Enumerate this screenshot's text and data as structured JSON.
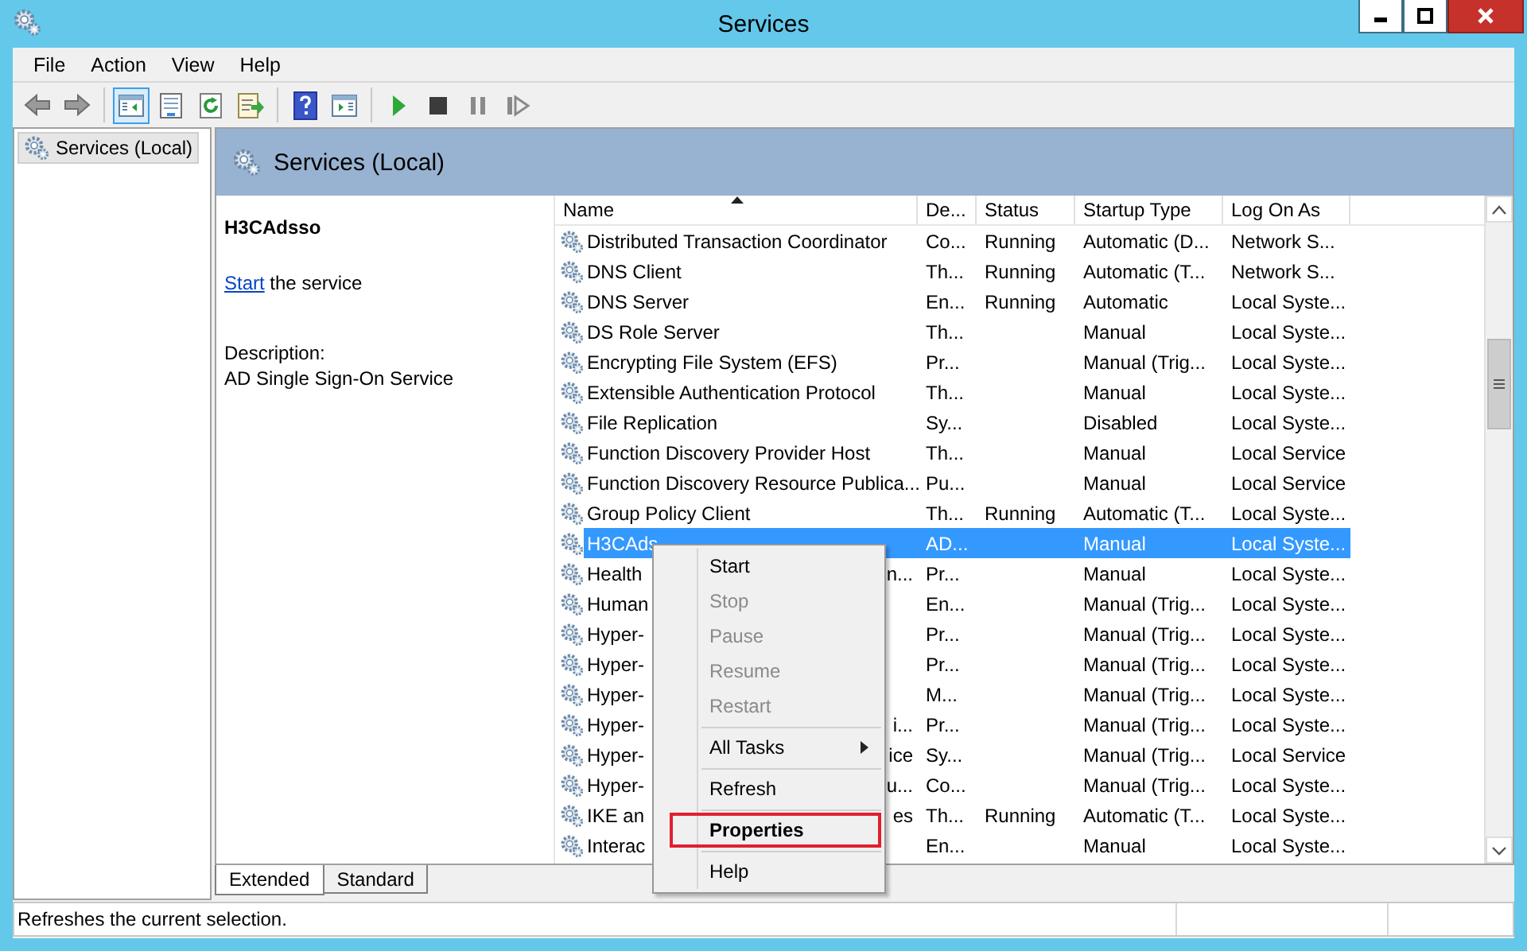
{
  "window": {
    "title": "Services"
  },
  "menu_bar": [
    "File",
    "Action",
    "View",
    "Help"
  ],
  "toolbar": [
    {
      "selected": false
    },
    {
      "selected": false
    },
    {
      "selected": true
    },
    {
      "selected": false
    },
    {
      "selected": false
    },
    {
      "selected": false
    },
    {
      "selected": false
    },
    {
      "selected": false
    },
    {
      "selected": false
    },
    {
      "selected": false
    },
    {
      "selected": false
    },
    {
      "selected": false
    }
  ],
  "tree": {
    "items": [
      {
        "label": "Services (Local)",
        "selected": true
      }
    ]
  },
  "panel": {
    "title": "Services (Local)"
  },
  "details": {
    "service_name": "H3CAdsso",
    "action_link": "Start",
    "action_text": "the service",
    "description_label": "Description:",
    "description": "AD Single Sign-On Service"
  },
  "table": {
    "columns": [
      {
        "label": "Name",
        "sorted": true
      },
      {
        "label": "De...",
        "sorted": false
      },
      {
        "label": "Status",
        "sorted": false
      },
      {
        "label": "Startup Type",
        "sorted": false
      },
      {
        "label": "Log On As",
        "sorted": false
      }
    ],
    "rows": [
      {
        "name": "Distributed Transaction Coordinator",
        "description": "Co...",
        "status": "Running",
        "startup_type": "Automatic (D...",
        "log_on_as": "Network S...",
        "selected": false
      },
      {
        "name": "DNS Client",
        "description": "Th...",
        "status": "Running",
        "startup_type": "Automatic (T...",
        "log_on_as": "Network S...",
        "selected": false
      },
      {
        "name": "DNS Server",
        "description": "En...",
        "status": "Running",
        "startup_type": "Automatic",
        "log_on_as": "Local Syste...",
        "selected": false
      },
      {
        "name": "DS Role Server",
        "description": "Th...",
        "status": "",
        "startup_type": "Manual",
        "log_on_as": "Local Syste...",
        "selected": false
      },
      {
        "name": "Encrypting File System (EFS)",
        "description": "Pr...",
        "status": "",
        "startup_type": "Manual (Trig...",
        "log_on_as": "Local Syste...",
        "selected": false
      },
      {
        "name": "Extensible Authentication Protocol",
        "description": "Th...",
        "status": "",
        "startup_type": "Manual",
        "log_on_as": "Local Syste...",
        "selected": false
      },
      {
        "name": "File Replication",
        "description": "Sy...",
        "status": "",
        "startup_type": "Disabled",
        "log_on_as": "Local Syste...",
        "selected": false
      },
      {
        "name": "Function Discovery Provider Host",
        "description": "Th...",
        "status": "",
        "startup_type": "Manual",
        "log_on_as": "Local Service",
        "selected": false
      },
      {
        "name": "Function Discovery Resource Publica...",
        "description": "Pu...",
        "status": "",
        "startup_type": "Manual",
        "log_on_as": "Local Service",
        "selected": false
      },
      {
        "name": "Group Policy Client",
        "description": "Th...",
        "status": "Running",
        "startup_type": "Automatic (T...",
        "log_on_as": "Local Syste...",
        "selected": false
      },
      {
        "name": "H3CAds",
        "description": "AD...",
        "status": "",
        "startup_type": "Manual",
        "log_on_as": "Local Syste...",
        "selected": true
      },
      {
        "name": "Health",
        "name_end": "n...",
        "description": "Pr...",
        "status": "",
        "startup_type": "Manual",
        "log_on_as": "Local Syste...",
        "selected": false
      },
      {
        "name": "Human",
        "description": "En...",
        "status": "",
        "startup_type": "Manual (Trig...",
        "log_on_as": "Local Syste...",
        "selected": false
      },
      {
        "name": "Hyper-",
        "description": "Pr...",
        "status": "",
        "startup_type": "Manual (Trig...",
        "log_on_as": "Local Syste...",
        "selected": false
      },
      {
        "name": "Hyper-",
        "description": "Pr...",
        "status": "",
        "startup_type": "Manual (Trig...",
        "log_on_as": "Local Syste...",
        "selected": false
      },
      {
        "name": "Hyper-",
        "description": "M...",
        "status": "",
        "startup_type": "Manual (Trig...",
        "log_on_as": "Local Syste...",
        "selected": false
      },
      {
        "name": "Hyper-",
        "name_end": "i...",
        "description": "Pr...",
        "status": "",
        "startup_type": "Manual (Trig...",
        "log_on_as": "Local Syste...",
        "selected": false
      },
      {
        "name": "Hyper-",
        "name_end": "ice",
        "description": "Sy...",
        "status": "",
        "startup_type": "Manual (Trig...",
        "log_on_as": "Local Service",
        "selected": false
      },
      {
        "name": "Hyper-",
        "name_end": "u...",
        "description": "Co...",
        "status": "",
        "startup_type": "Manual (Trig...",
        "log_on_as": "Local Syste...",
        "selected": false
      },
      {
        "name": "IKE an",
        "name_end": "es",
        "description": "Th...",
        "status": "Running",
        "startup_type": "Automatic (T...",
        "log_on_as": "Local Syste...",
        "selected": false
      },
      {
        "name": "Interac",
        "description": "En...",
        "status": "",
        "startup_type": "Manual",
        "log_on_as": "Local Syste...",
        "selected": false
      }
    ]
  },
  "context_menu": {
    "items": [
      {
        "kind": "item",
        "label": "Start",
        "disabled": false
      },
      {
        "kind": "item",
        "label": "Stop",
        "disabled": true
      },
      {
        "kind": "item",
        "label": "Pause",
        "disabled": true
      },
      {
        "kind": "item",
        "label": "Resume",
        "disabled": true
      },
      {
        "kind": "item",
        "label": "Restart",
        "disabled": true
      },
      {
        "kind": "separator"
      },
      {
        "kind": "submenu",
        "label": "All Tasks",
        "disabled": false
      },
      {
        "kind": "separator"
      },
      {
        "kind": "item",
        "label": "Refresh",
        "disabled": false
      },
      {
        "kind": "separator"
      },
      {
        "kind": "item",
        "label": "Properties",
        "disabled": false,
        "default": true,
        "outlined": true
      },
      {
        "kind": "separator"
      },
      {
        "kind": "item",
        "label": "Help",
        "disabled": false
      }
    ]
  },
  "view_tabs": [
    {
      "label": "Extended",
      "selected": true
    },
    {
      "label": "Standard",
      "selected": false
    }
  ],
  "status_bar": {
    "text": "Refreshes the current selection."
  }
}
